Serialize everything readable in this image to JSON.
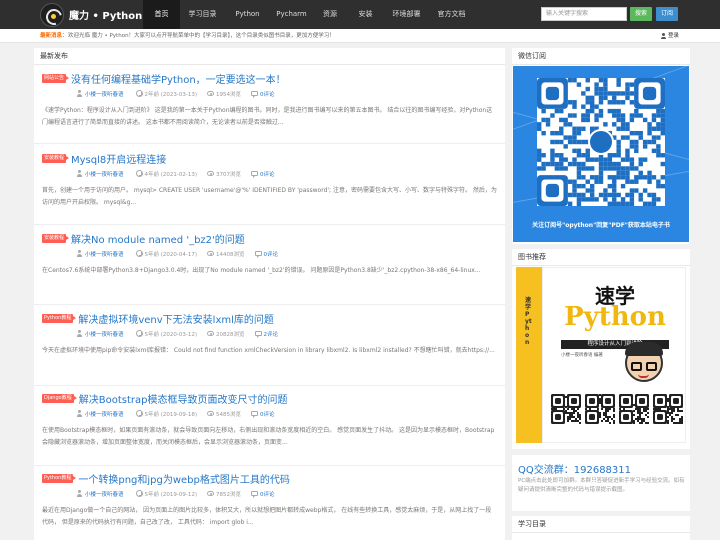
{
  "header": {
    "logo_text": "魔力 • Python",
    "nav": [
      {
        "label": "首页",
        "active": true
      },
      {
        "label": "学习目录",
        "active": false
      },
      {
        "label": "Python",
        "active": false
      },
      {
        "label": "Pycharm",
        "active": false
      },
      {
        "label": "资源",
        "active": false
      },
      {
        "label": "安装",
        "active": false
      },
      {
        "label": "环境部署",
        "active": false
      },
      {
        "label": "官方文档",
        "active": false
      }
    ],
    "search_placeholder": "输入关键字搜索",
    "search_button": "搜索",
    "subscribe_button": "订阅"
  },
  "notice": {
    "label": "最新消息：",
    "text": "欢迎光临 魔力 • Python！大家可以点开导航菜单中的【学习目录】，这个目录类似图书目录，更加方便学习！",
    "login": "登录"
  },
  "main": {
    "heading": "最新发布",
    "posts": [
      {
        "tag": "网站公告",
        "title": "没有任何编程基础学Python，一定要选这一本！",
        "author": "小楼一夜听春语",
        "time": "2年前 (2023-03-13)",
        "views": "1954浏览",
        "comments": "0评论",
        "excerpt": "《速学Python：程序设计从入门到进阶》 这是我的第一本关于Python编程的图书。同时，是我进行图书编写以来的第五本图书。 结合以往的图书编写经验，对Python这门编程语言进行了简单而直接的讲述。 这本书都不用阅读简介，无论读者以前是否接触过..."
      },
      {
        "tag": "安装教程",
        "title": "Mysql8开启远程连接",
        "author": "小楼一夜听春语",
        "time": "4年前 (2021-02-13)",
        "views": "3707浏览",
        "comments": "0评论",
        "excerpt": "首先，创建一个用于访问的用户。 mysql> CREATE USER 'username'@'%' IDENTIFIED BY 'password'; 注意，密码需要包含大写、小写、数字与特殊字符。 然后，为访问的用户开启权限。 mysql&g..."
      },
      {
        "tag": "安装教程",
        "title": "解决No module named '_bz2'的问题",
        "author": "小楼一夜听春语",
        "time": "5年前 (2020-04-17)",
        "views": "14408浏览",
        "comments": "0评论",
        "excerpt": "在Centos7.6系统中部署Python3.8+Django3.0.4时，出现了No module named '_bz2'的错误。 问题原因是Python3.8缺少'_bz2.cpython-38-x86_64-linux..."
      },
      {
        "tag": "Python教程",
        "title": "解决虚拟环境venv下无法安装lxml库的问题",
        "author": "小楼一夜听春语",
        "time": "5年前 (2020-03-12)",
        "views": "20828浏览",
        "comments": "2评论",
        "excerpt": "今天在虚拟环境中使用pip命令安装lxml库报错： Could not find function xmlCheckVersion in library libxml2. Is libxml2 installed? 不想瞎忙叫错，就去https://..."
      },
      {
        "tag": "Django教程",
        "title": "解决Bootstrap模态框导致页面改变尺寸的问题",
        "author": "小楼一夜听春语",
        "time": "5年前 (2019-09-18)",
        "views": "5485浏览",
        "comments": "0评论",
        "excerpt": "在使用Bootstrap模态框时，如果页面有滚动条，就会导致页面向左移动，右侧出现和滚动条宽度相近的空白。 感觉页面发生了抖动。 这是因为显示模态框时，Bootstrap会隐藏浏览器滚动条，增加页面整体宽度，而关闭模态框后，会显示浏览器滚动条，页面变..."
      },
      {
        "tag": "Python教程",
        "title": "一个转换png和jpg为webp格式图片工具的代码",
        "author": "小楼一夜听春语",
        "time": "5年前 (2019-09-12)",
        "views": "7852浏览",
        "comments": "0评论",
        "excerpt": "最近在用Django做一个自己的网站， 因为页面上的图片比较多，体积又大，所以就想把图片都转成webp格式， 在线有些转换工具，感觉太麻烦，于是，从网上找了一段代码， 但是原来的代码执行有问题，自己改了改， 工具代码： import glob i..."
      }
    ]
  },
  "sidebar": {
    "wechat_heading": "微信订阅",
    "wechat_caption": "关注订阅号\"opython\"回复\"PDF\"获取本站电子书",
    "book_heading": "图书推荐",
    "book": {
      "title_cn": "速学",
      "title_en": "Python",
      "subtitle": "程序设计从入门到进阶",
      "author": "小楼一夜听春语  编著",
      "spine": "速学Python"
    },
    "qq_title": "QQ交流群：192688311",
    "qq_desc": "PC端点击此处即可加群。本群只答疑促进新手学习与经验交流。如有疑问请提供清晰完整的代码与错误提示截图。",
    "toc_heading": "学习目录"
  },
  "colors": {
    "topbar": "#2f2f2f",
    "link": "#2577c8",
    "tag": "#ff5e52",
    "search_btn": "#5cb85c",
    "sub_btn": "#3b8fd0",
    "wechat_bg": "#2a86e0",
    "book_yellow": "#f7c021"
  }
}
